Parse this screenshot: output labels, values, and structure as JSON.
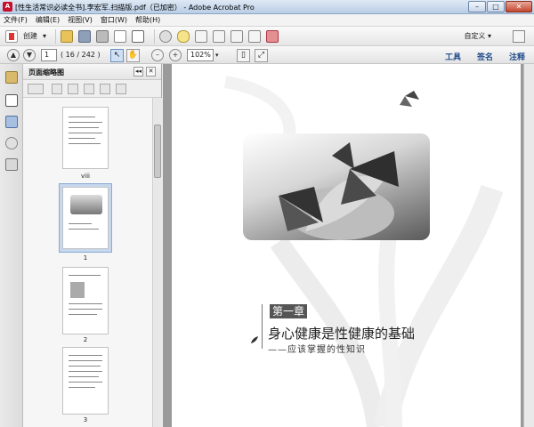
{
  "window": {
    "title": "[性生活常识必读全书].李宏军.扫描版.pdf（已加密） - Adobe Acrobat Pro",
    "minimize": "–",
    "maximize": "□",
    "close": "✕"
  },
  "menu": {
    "items": [
      "文件(F)",
      "编辑(E)",
      "视图(V)",
      "窗口(W)",
      "帮助(H)"
    ]
  },
  "toolbar1": {
    "create_label": "创建",
    "create_arrow": "▾",
    "customize_label": "自定义",
    "customize_arrow": "▾"
  },
  "toolbar2": {
    "page_current": "1",
    "page_total": "( 16 / 242 )",
    "zoom_value": "102%",
    "zoom_arrow": "▾",
    "tabs": [
      "工具",
      "签名",
      "注释"
    ]
  },
  "panel": {
    "title": "页面缩略图",
    "collapse": "◂◂",
    "close": "✕",
    "thumbnails": [
      {
        "label": "viii"
      },
      {
        "label": "1"
      },
      {
        "label": "2"
      },
      {
        "label": "3"
      }
    ]
  },
  "page": {
    "chapter_tag": "第一章",
    "chapter_title": "身心健康是性健康的基础",
    "chapter_subtitle": "——应该掌握的性知识"
  }
}
